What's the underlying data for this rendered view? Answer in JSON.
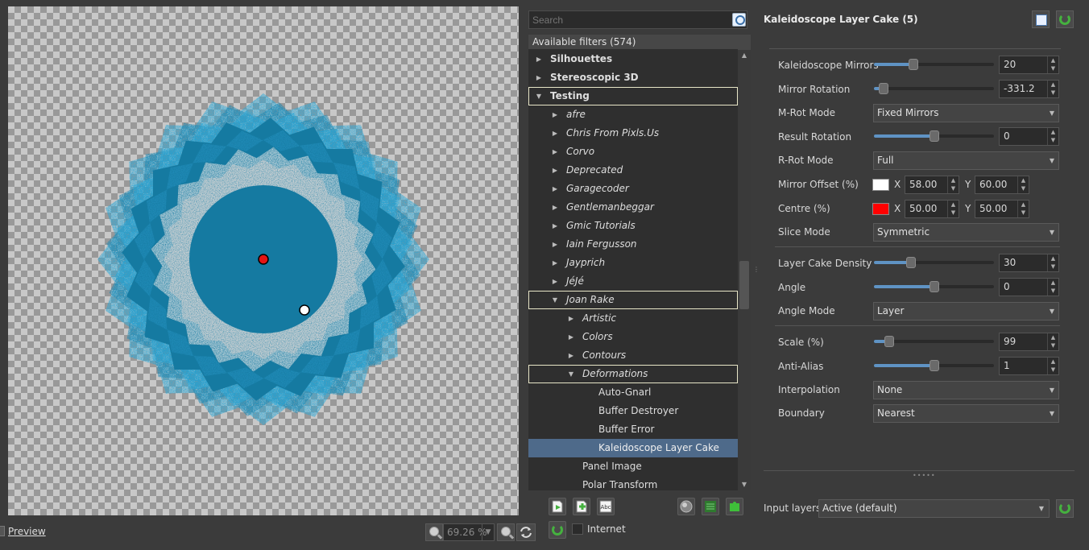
{
  "preview": {
    "label": "Preview",
    "zoom": "69.26 %"
  },
  "filters": {
    "search_placeholder": "Search",
    "header": "Available filters (574)",
    "tree": [
      {
        "label": "Silhouettes",
        "level": 0,
        "expanded": false,
        "style": "bold"
      },
      {
        "label": "Stereoscopic 3D",
        "level": 0,
        "expanded": false,
        "style": "bold"
      },
      {
        "label": "Testing",
        "level": 0,
        "expanded": true,
        "style": "bold",
        "outlined": true
      },
      {
        "label": "afre",
        "level": 1,
        "expanded": false,
        "style": "italic"
      },
      {
        "label": "Chris From Pixls.Us",
        "level": 1,
        "expanded": false,
        "style": "italic"
      },
      {
        "label": "Corvo",
        "level": 1,
        "expanded": false,
        "style": "italic"
      },
      {
        "label": "Deprecated",
        "level": 1,
        "expanded": false,
        "style": "italic"
      },
      {
        "label": "Garagecoder",
        "level": 1,
        "expanded": false,
        "style": "italic"
      },
      {
        "label": "Gentlemanbeggar",
        "level": 1,
        "expanded": false,
        "style": "italic"
      },
      {
        "label": "Gmic Tutorials",
        "level": 1,
        "expanded": false,
        "style": "italic"
      },
      {
        "label": "Iain Fergusson",
        "level": 1,
        "expanded": false,
        "style": "italic"
      },
      {
        "label": "Jayprich",
        "level": 1,
        "expanded": false,
        "style": "italic"
      },
      {
        "label": "JéJé",
        "level": 1,
        "expanded": false,
        "style": "italic"
      },
      {
        "label": "Joan Rake",
        "level": 1,
        "expanded": true,
        "style": "italic",
        "outlined": true
      },
      {
        "label": "Artistic",
        "level": 2,
        "expanded": false,
        "style": "italic"
      },
      {
        "label": "Colors",
        "level": 2,
        "expanded": false,
        "style": "italic"
      },
      {
        "label": "Contours",
        "level": 2,
        "expanded": false,
        "style": "italic"
      },
      {
        "label": "Deformations",
        "level": 2,
        "expanded": true,
        "style": "italic",
        "outlined": true
      },
      {
        "label": "Auto-Gnarl",
        "level": 3,
        "leaf": true
      },
      {
        "label": "Buffer Destroyer",
        "level": 3,
        "leaf": true
      },
      {
        "label": "Buffer Error",
        "level": 3,
        "leaf": true
      },
      {
        "label": "Kaleidoscope Layer Cake",
        "level": 3,
        "leaf": true,
        "selected": true
      },
      {
        "label": "Panel Image",
        "level": 2,
        "leaf": true
      },
      {
        "label": "Polar Transform",
        "level": 2,
        "leaf": true
      }
    ],
    "internet_label": "Internet"
  },
  "params": {
    "title": "Kaleidoscope Layer Cake (5)",
    "kaleidoscope_mirrors": {
      "label": "Kaleidoscope Mirrors",
      "value": "20",
      "fraction": 0.33
    },
    "mirror_rotation": {
      "label": "Mirror Rotation",
      "value": "-331.2",
      "fraction": 0.08
    },
    "m_rot_mode": {
      "label": "M-Rot Mode",
      "value": "Fixed Mirrors"
    },
    "result_rotation": {
      "label": "Result Rotation",
      "value": "0",
      "fraction": 0.5
    },
    "r_rot_mode": {
      "label": "R-Rot Mode",
      "value": "Full"
    },
    "mirror_offset": {
      "label": "Mirror Offset (%)",
      "x_label": "X",
      "x": "58.00",
      "y_label": "Y",
      "y": "60.00",
      "color": "#ffffff"
    },
    "centre": {
      "label": "Centre (%)",
      "x_label": "X",
      "x": "50.00",
      "y_label": "Y",
      "y": "50.00",
      "color": "#ff0000"
    },
    "slice_mode": {
      "label": "Slice Mode",
      "value": "Symmetric"
    },
    "layer_cake_density": {
      "label": "Layer Cake Density",
      "value": "30",
      "fraction": 0.31
    },
    "angle": {
      "label": "Angle",
      "value": "0",
      "fraction": 0.5
    },
    "angle_mode": {
      "label": "Angle Mode",
      "value": "Layer"
    },
    "scale": {
      "label": "Scale (%)",
      "value": "99",
      "fraction": 0.13
    },
    "anti_alias": {
      "label": "Anti-Alias",
      "value": "1",
      "fraction": 0.5
    },
    "interpolation": {
      "label": "Interpolation",
      "value": "None"
    },
    "boundary": {
      "label": "Boundary",
      "value": "Nearest"
    }
  },
  "input_layers": {
    "label": "Input layers",
    "value": "Active (default)"
  },
  "colors": {
    "accent": "#4e6a8a",
    "kaleido_blue": "#157aa1",
    "kaleido_light": "#2aa8d8",
    "slider_fill": "#5f93c4",
    "green_icon": "#45b13f"
  }
}
